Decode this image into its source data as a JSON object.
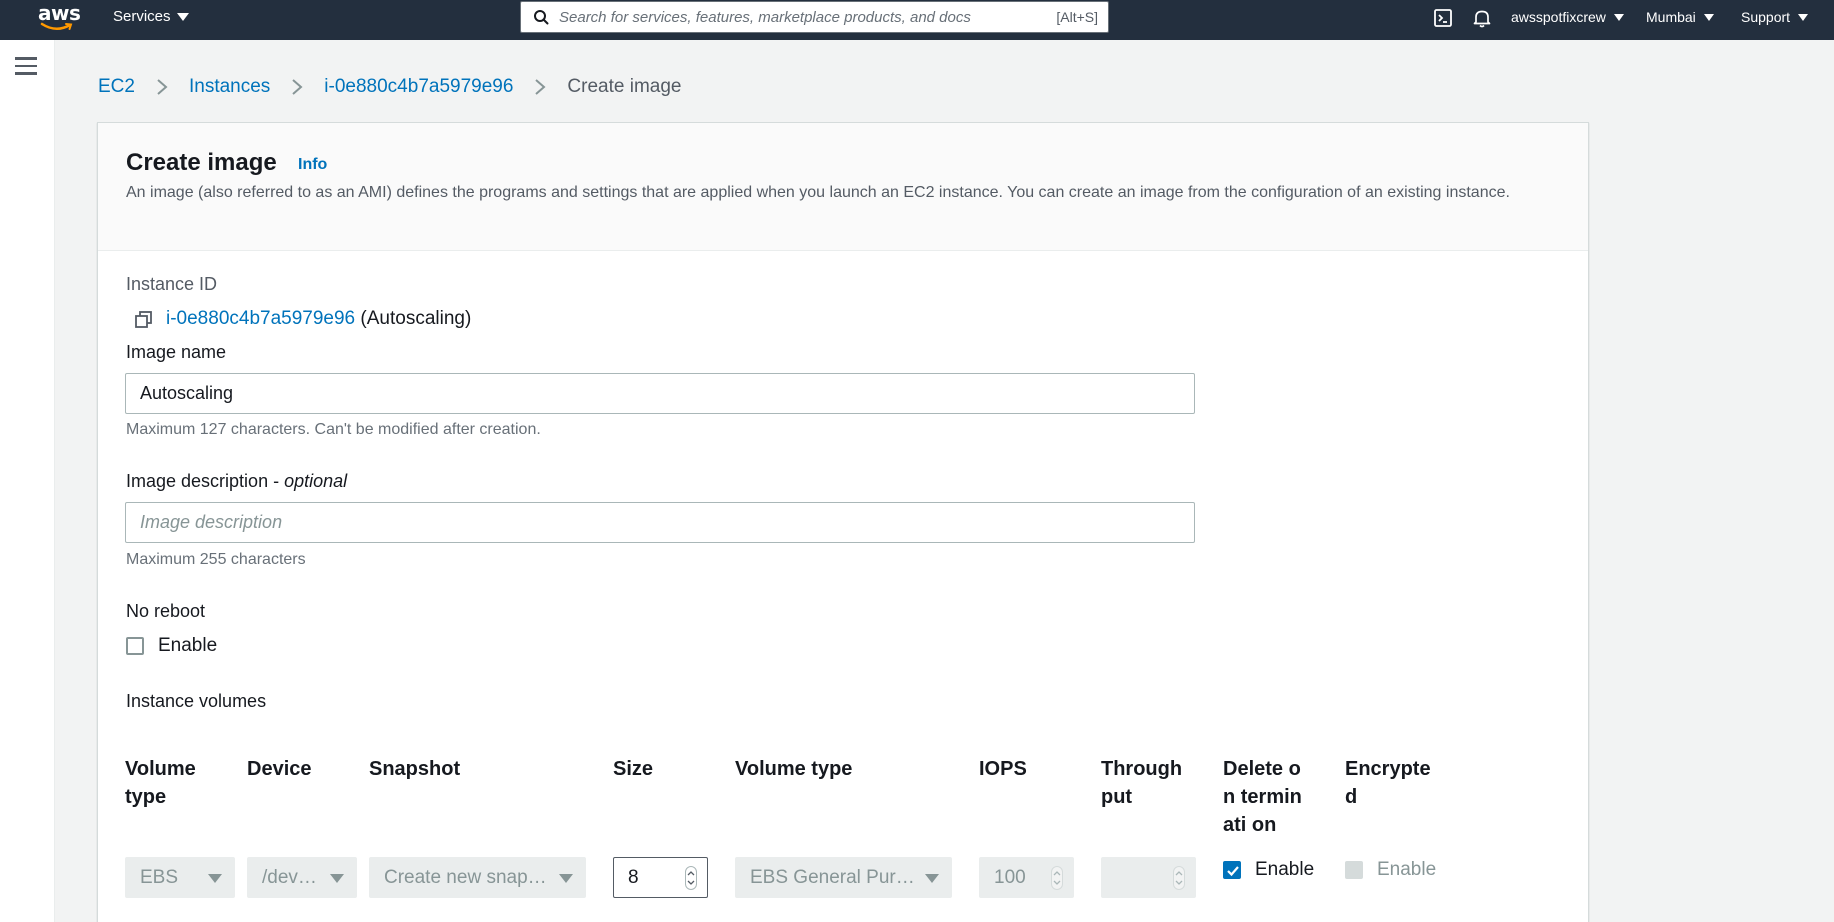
{
  "topnav": {
    "logo_text": "aws",
    "services_label": "Services",
    "search_placeholder": "Search for services, features, marketplace products, and docs",
    "search_shortcut": "[Alt+S]",
    "account": "awsspotfixcrew",
    "region": "Mumbai",
    "support": "Support"
  },
  "breadcrumb": {
    "items": [
      "EC2",
      "Instances",
      "i-0e880c4b7a5979e96"
    ],
    "current": "Create image"
  },
  "header": {
    "title": "Create image",
    "info": "Info",
    "description": "An image (also referred to as an AMI) defines the programs and settings that are applied when you launch an EC2 instance. You can create an image from the configuration of an existing instance."
  },
  "form": {
    "instance_id_label": "Instance ID",
    "instance_id": "i-0e880c4b7a5979e96",
    "instance_name": "(Autoscaling)",
    "image_name_label": "Image name",
    "image_name_value": "Autoscaling",
    "image_name_hint": "Maximum 127 characters. Can't be modified after creation.",
    "image_desc_label": "Image description - ",
    "image_desc_optional": "optional",
    "image_desc_placeholder": "Image description",
    "image_desc_hint": "Maximum 255 characters",
    "no_reboot_label": "No reboot",
    "no_reboot_checkbox": "Enable",
    "no_reboot_checked": false,
    "volumes_label": "Instance volumes"
  },
  "volumes_table": {
    "headers": {
      "volume_type": "Volume type",
      "device": "Device",
      "snapshot": "Snapshot",
      "size": "Size",
      "ebs_volume_type": "Volume type",
      "iops": "IOPS",
      "throughput": "Through put",
      "delete_on_termination": "Delete on terminati on",
      "encrypted": "Encrypte d"
    },
    "row": {
      "volume_type": "EBS",
      "device": "/dev…",
      "snapshot": "Create new snap…",
      "size": "8",
      "ebs_volume_type": "EBS General Pur…",
      "iops": "100",
      "throughput": "",
      "delete_on_termination_label": "Enable",
      "delete_on_termination_checked": true,
      "encrypted_label": "Enable",
      "encrypted_checked": false
    }
  },
  "colors": {
    "nav_bg": "#232f3e",
    "link": "#0073bb",
    "page_bg": "#f2f3f3"
  }
}
